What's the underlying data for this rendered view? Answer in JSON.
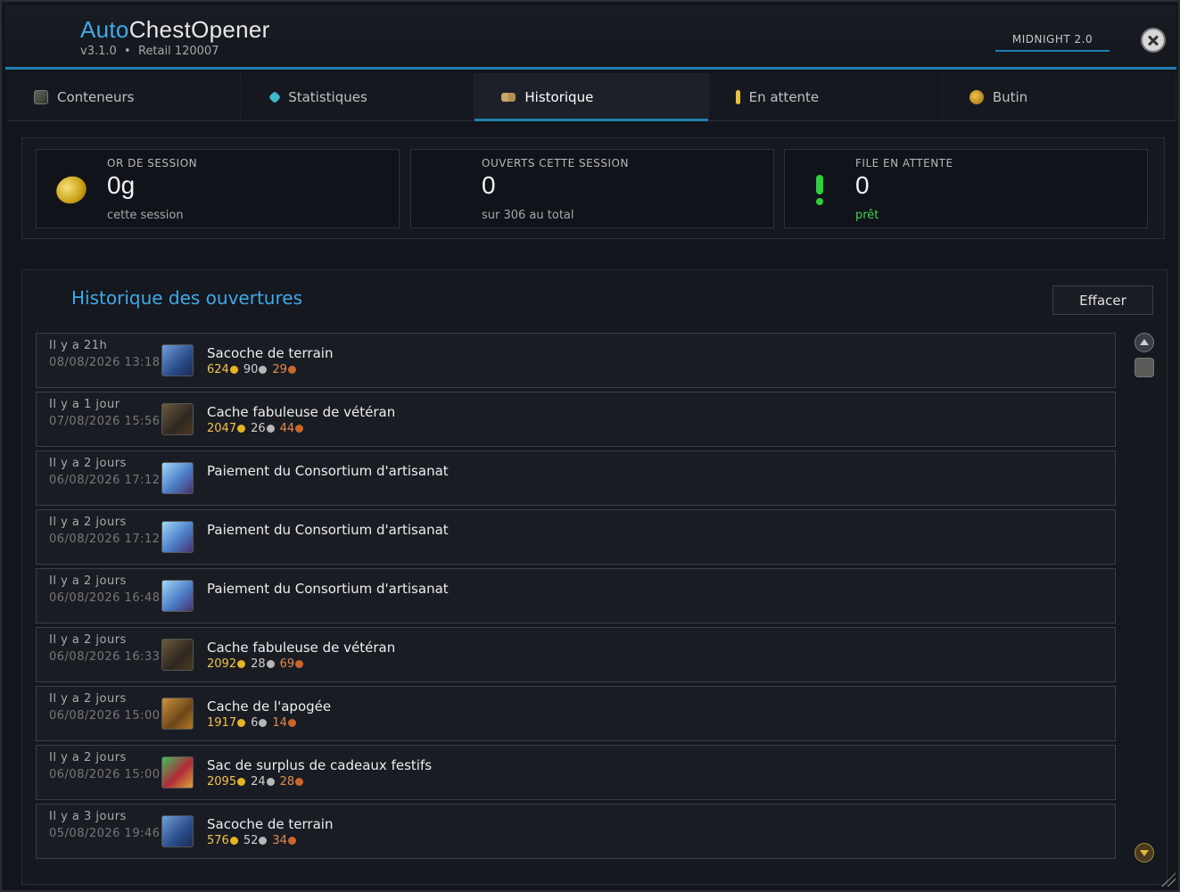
{
  "header": {
    "title_accent": "Auto",
    "title_rest": "ChestOpener",
    "version": "v3.1.0",
    "separator": "•",
    "build": "Retail 120007",
    "badge": "MIDNIGHT 2.0",
    "close_icon": "close-icon"
  },
  "tabs": [
    {
      "label": "Conteneurs",
      "icon": "chest-icon"
    },
    {
      "label": "Statistiques",
      "icon": "gem-icon"
    },
    {
      "label": "Historique",
      "icon": "book-icon",
      "active": true
    },
    {
      "label": "En attente",
      "icon": "exclamation-icon"
    },
    {
      "label": "Butin",
      "icon": "coins-icon"
    }
  ],
  "stats": {
    "gold": {
      "label": "OR DE SESSION",
      "value": "0g",
      "sub": "cette session"
    },
    "opened": {
      "label": "OUVERTS CETTE SESSION",
      "value": "0",
      "sub": "sur 306 au total"
    },
    "queue": {
      "label": "FILE EN ATTENTE",
      "value": "0",
      "sub": "prêt"
    }
  },
  "history": {
    "title": "Historique des ouvertures",
    "clear_label": "Effacer",
    "rows": [
      {
        "when": "Il y a 21h",
        "date": "08/08/2026 13:18",
        "name": "Sacoche de terrain",
        "icon": "ic-satchel",
        "gold": "624",
        "silver": "90",
        "copper": "29"
      },
      {
        "when": "Il y a 1 jour",
        "date": "07/08/2026 15:56",
        "name": "Cache fabuleuse de vétéran",
        "icon": "ic-cache",
        "gold": "2047",
        "silver": "26",
        "copper": "44"
      },
      {
        "when": "Il y a 2 jours",
        "date": "06/08/2026 17:12",
        "name": "Paiement du Consortium d'artisanat",
        "icon": "ic-consortium",
        "gold": "",
        "silver": "",
        "copper": ""
      },
      {
        "when": "Il y a 2 jours",
        "date": "06/08/2026 17:12",
        "name": "Paiement du Consortium d'artisanat",
        "icon": "ic-consortium",
        "gold": "",
        "silver": "",
        "copper": ""
      },
      {
        "when": "Il y a 2 jours",
        "date": "06/08/2026 16:48",
        "name": "Paiement du Consortium d'artisanat",
        "icon": "ic-consortium",
        "gold": "",
        "silver": "",
        "copper": ""
      },
      {
        "when": "Il y a 2 jours",
        "date": "06/08/2026 16:33",
        "name": "Cache fabuleuse de vétéran",
        "icon": "ic-cache",
        "gold": "2092",
        "silver": "28",
        "copper": "69"
      },
      {
        "when": "Il y a 2 jours",
        "date": "06/08/2026 15:00",
        "name": "Cache de l'apogée",
        "icon": "ic-apogee",
        "gold": "1917",
        "silver": "6",
        "copper": "14"
      },
      {
        "when": "Il y a 2 jours",
        "date": "06/08/2026 15:00",
        "name": "Sac de surplus de cadeaux festifs",
        "icon": "ic-festive",
        "gold": "2095",
        "silver": "24",
        "copper": "28"
      },
      {
        "when": "Il y a 3 jours",
        "date": "05/08/2026 19:46",
        "name": "Sacoche de terrain",
        "icon": "ic-satchel",
        "gold": "576",
        "silver": "52",
        "copper": "34"
      }
    ]
  }
}
